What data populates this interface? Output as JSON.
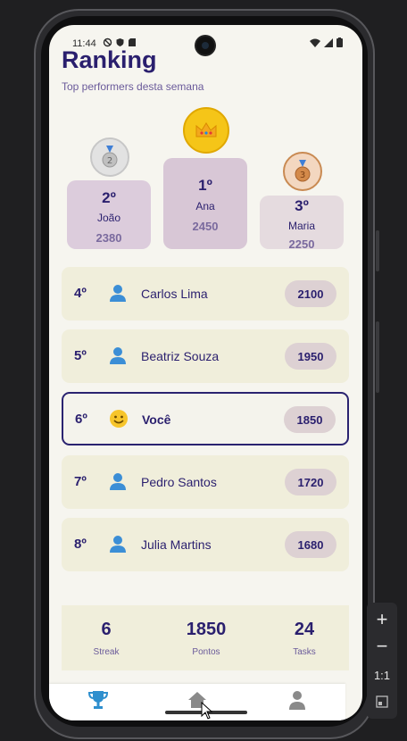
{
  "status_bar": {
    "time": "11:44"
  },
  "header": {
    "title": "Ranking",
    "subtitle": "Top performers desta semana"
  },
  "podium": [
    {
      "rank": "1º",
      "name": "Ana",
      "points": "2450",
      "medal": "crown-icon",
      "color": "#d8c7d6"
    },
    {
      "rank": "2º",
      "name": "João",
      "points": "2380",
      "medal": "silver-medal-icon",
      "color": "#dcccdc"
    },
    {
      "rank": "3º",
      "name": "Maria",
      "points": "2250",
      "medal": "bronze-medal-icon",
      "color": "#e5dbdf"
    }
  ],
  "ranking": [
    {
      "rank": "4º",
      "name": "Carlos Lima",
      "points": "2100",
      "avatar": "person-icon"
    },
    {
      "rank": "5º",
      "name": "Beatriz Souza",
      "points": "1950",
      "avatar": "person-icon"
    },
    {
      "rank": "6º",
      "name": "Você",
      "points": "1850",
      "avatar": "smile-icon"
    },
    {
      "rank": "7º",
      "name": "Pedro Santos",
      "points": "1720",
      "avatar": "person-icon"
    },
    {
      "rank": "8º",
      "name": "Julia Martins",
      "points": "1680",
      "avatar": "person-icon"
    }
  ],
  "stats": [
    {
      "value": "6",
      "label": "Streak"
    },
    {
      "value": "1850",
      "label": "Pontos"
    },
    {
      "value": "24",
      "label": "Tasks"
    }
  ],
  "nav": [
    {
      "icon": "trophy-icon",
      "active": true
    },
    {
      "icon": "home-icon",
      "active": false
    },
    {
      "icon": "profile-icon",
      "active": false
    }
  ],
  "zoom_panel": {
    "ratio_label": "1:1"
  },
  "colors": {
    "primary": "#2a1f6e",
    "card": "#f0eedb",
    "background": "#f6f5ef",
    "active_tab": "#2e8fce"
  }
}
